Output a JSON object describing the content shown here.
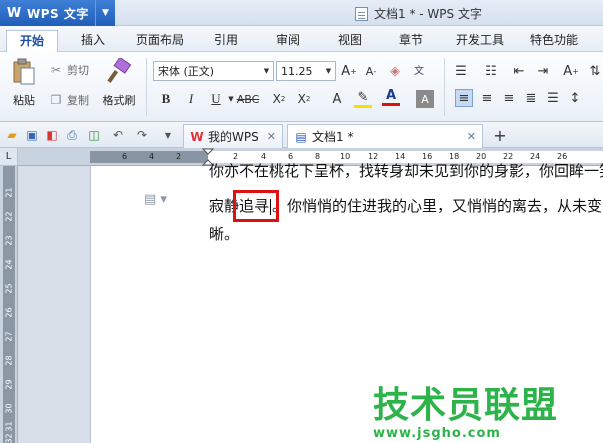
{
  "titlebar": {
    "app_button_label": "WPS 文字",
    "window_title": "文档1 * - WPS 文字"
  },
  "menu": {
    "tabs": [
      "开始",
      "插入",
      "页面布局",
      "引用",
      "审阅",
      "视图",
      "章节",
      "开发工具",
      "特色功能"
    ],
    "active": "开始"
  },
  "ribbon": {
    "paste_label": "粘贴",
    "cut_label": "剪切",
    "copy_label": "复制",
    "format_painter_label": "格式刷",
    "font_name": "宋体 (正文)",
    "font_size": "11.25"
  },
  "tabs": {
    "home_tab_label": "我的WPS",
    "doc_tab_label": "文档1 *"
  },
  "ruler": {
    "h_numbers": [
      "6",
      "4",
      "2",
      "2",
      "4",
      "6",
      "8",
      "10",
      "12",
      "14",
      "16",
      "18",
      "20",
      "22",
      "24",
      "26"
    ],
    "v_numbers": [
      "21",
      "22",
      "23",
      "24",
      "25",
      "26",
      "27",
      "28",
      "29",
      "30",
      "31",
      "32"
    ],
    "corner_label": "L"
  },
  "document": {
    "line1": "你亦不在桃花下呈杯，找转身却未见到你的身影，你回眸一笑，",
    "line2_before": "寂静",
    "line2_selected": "追寻",
    "line2_after": "。你悄悄的住进我的心里，又悄悄的离去，从未变的",
    "line3": "晰。"
  },
  "watermark": {
    "title": "技术员联盟",
    "url": "www.jsgho.com"
  },
  "colors": {
    "title_bar_accent": "#1f5fb8",
    "highlight_box": "#dd1111",
    "watermark": "#2eb34a"
  }
}
